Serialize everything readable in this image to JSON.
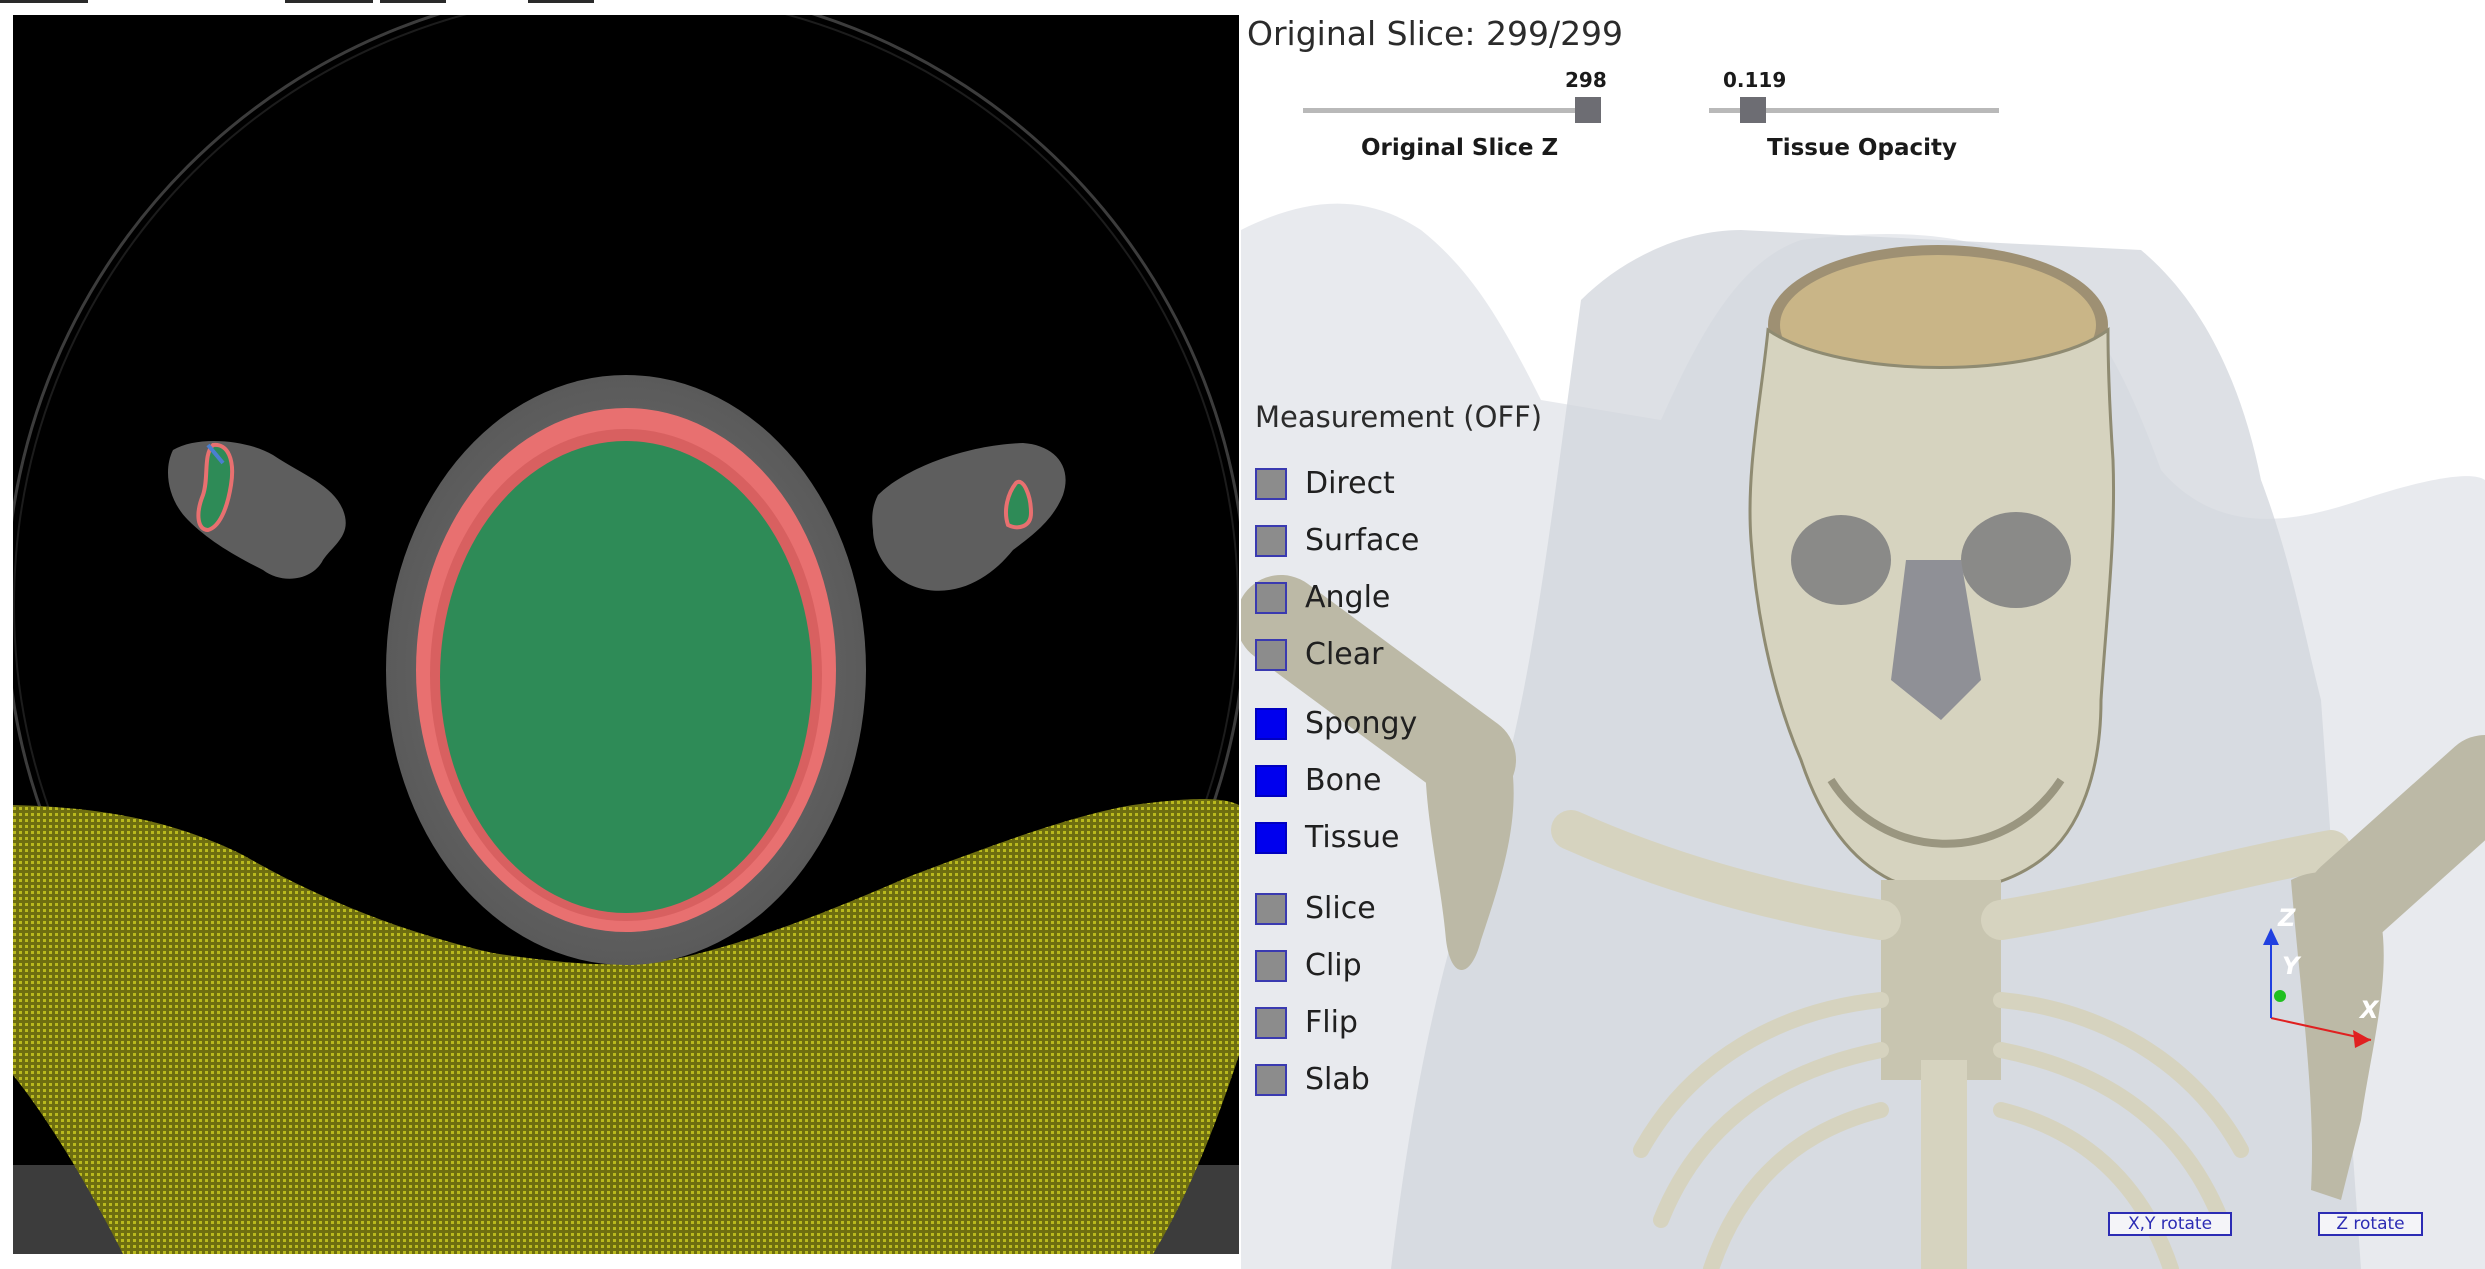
{
  "slice_info": {
    "title": "Original Slice: 299/299"
  },
  "sliders": [
    {
      "value": "298",
      "label": "Original Slice Z",
      "fraction": 0.94
    },
    {
      "value": "0.119",
      "label": "Tissue Opacity",
      "fraction": 0.12
    }
  ],
  "measurement": {
    "title": "Measurement (OFF)",
    "items": [
      {
        "label": "Direct",
        "checked": false
      },
      {
        "label": "Surface",
        "checked": false
      },
      {
        "label": "Angle",
        "checked": false
      },
      {
        "label": "Clear",
        "checked": false
      }
    ]
  },
  "layers": [
    {
      "label": "Spongy",
      "checked": true
    },
    {
      "label": "Bone",
      "checked": true
    },
    {
      "label": "Tissue",
      "checked": true
    }
  ],
  "view_options": [
    {
      "label": "Slice",
      "checked": false
    },
    {
      "label": "Clip",
      "checked": false
    },
    {
      "label": "Flip",
      "checked": false
    },
    {
      "label": "Slab",
      "checked": false
    }
  ],
  "axes": {
    "x": "X",
    "y": "Y",
    "z": "Z"
  },
  "rotate_buttons": {
    "xy": "X,Y rotate",
    "z": "Z rotate"
  },
  "colors": {
    "checkbox_on": "#0000ee",
    "checkbox_off": "#8c8c8c",
    "segmentation_brain": "#2e8b57",
    "segmentation_skull": "#e87070",
    "table_overlay": "#9a9a1a",
    "bone": "#d6d3bf"
  }
}
